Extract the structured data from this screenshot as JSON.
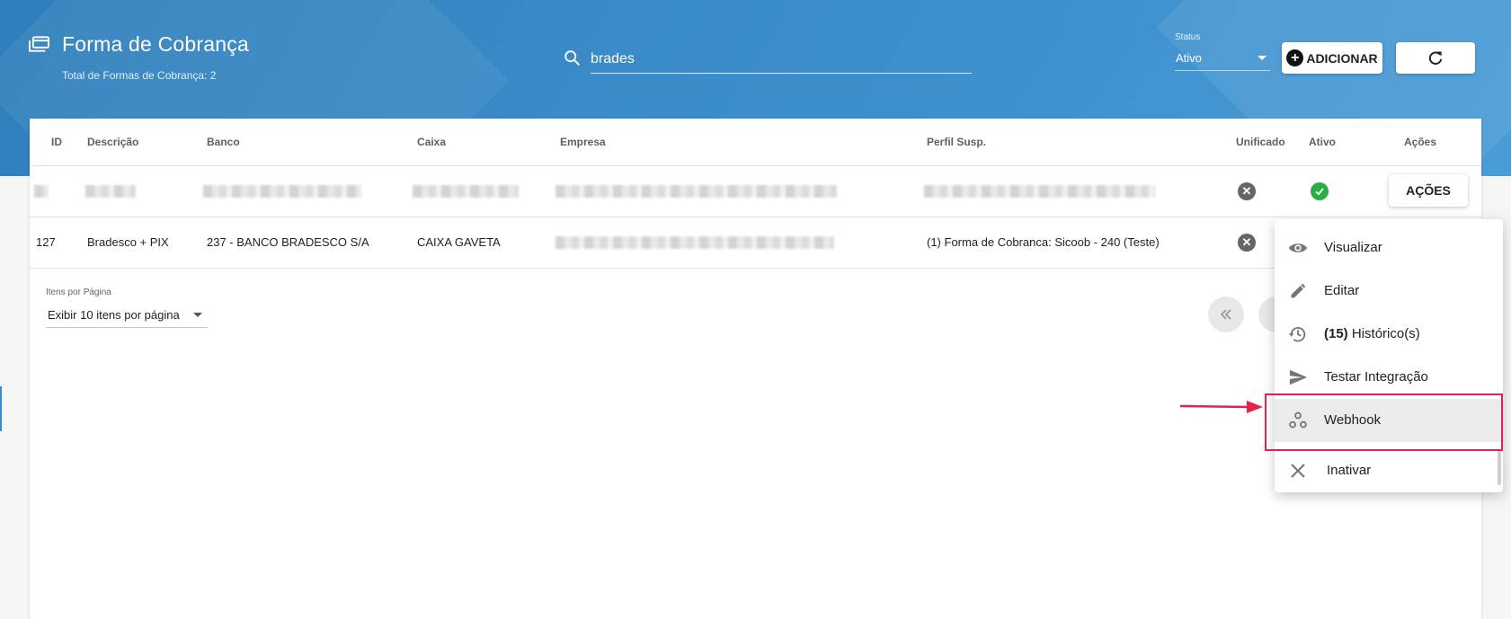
{
  "header": {
    "title": "Forma de Cobrança",
    "subtitle": "Total de Formas de Cobrança: 2",
    "search_value": "brades",
    "status_label": "Status",
    "status_value": "Ativo",
    "add_label": "ADICIONAR"
  },
  "table": {
    "columns": [
      "ID",
      "Descrição",
      "Banco",
      "Caixa",
      "Empresa",
      "Perfil Susp.",
      "Unificado",
      "Ativo",
      "Ações"
    ],
    "rows": [
      {
        "id": "",
        "descricao": "",
        "banco": "",
        "caixa": "",
        "empresa": "",
        "perfil": "",
        "unificado": "no",
        "ativo": "yes",
        "acoes_label": "AÇÕES"
      },
      {
        "id": "127",
        "descricao": "Bradesco + PIX",
        "banco": "237 - BANCO BRADESCO S/A",
        "caixa": "CAIXA GAVETA",
        "empresa": "",
        "perfil": "(1) Forma de Cobranca: Sicoob - 240 (Teste)",
        "unificado": "no",
        "ativo": ""
      }
    ]
  },
  "pagination": {
    "label": "Itens por Página",
    "value": "Exibir 10 itens por página"
  },
  "menu": {
    "items": [
      {
        "label": "Visualizar",
        "icon": "eye-icon"
      },
      {
        "label": "Editar",
        "icon": "pencil-icon"
      },
      {
        "count": "(15)",
        "label": " Histórico(s)",
        "icon": "history-icon"
      },
      {
        "label": "Testar Integração",
        "icon": "send-icon"
      },
      {
        "label": "Webhook",
        "icon": "webhook-icon"
      },
      {
        "label": "Inativar",
        "icon": "close-icon"
      }
    ]
  },
  "colors": {
    "header": "#3a8bc8",
    "highlight": "#e8204e",
    "ok": "#27ae44"
  }
}
